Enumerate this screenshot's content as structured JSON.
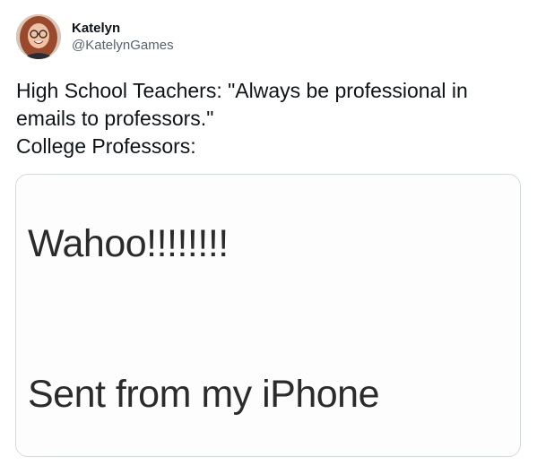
{
  "author": {
    "display_name": "Katelyn",
    "handle": "@KatelynGames",
    "avatar_icon": "profile-photo"
  },
  "tweet": {
    "lines": [
      "High School Teachers: \"Always be professional in",
      "emails to professors.\"",
      "College Professors:"
    ]
  },
  "media": {
    "email_body": "Wahoo!!!!!!!!",
    "email_signature": "Sent from my iPhone"
  },
  "colors": {
    "text_primary": "#0f1419",
    "text_secondary": "#536471",
    "card_border": "#cfd9de"
  }
}
